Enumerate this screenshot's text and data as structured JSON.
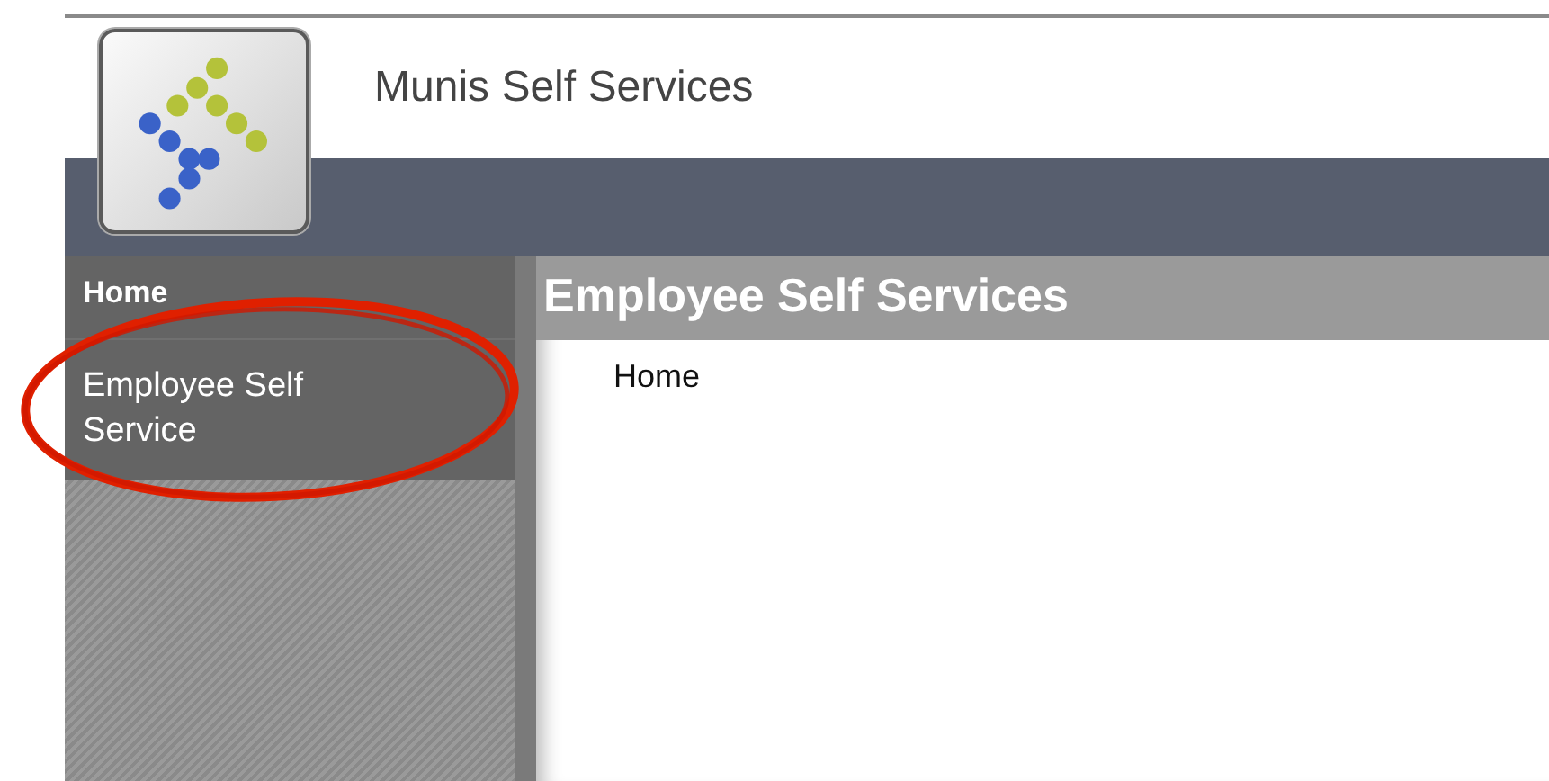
{
  "header": {
    "title": "Munis Self Services"
  },
  "sidebar": {
    "items": [
      {
        "label": "Home",
        "kind": "heading"
      },
      {
        "label": "Employee Self Service",
        "kind": "link"
      }
    ]
  },
  "content": {
    "title": "Employee Self Services",
    "breadcrumb": "Home"
  }
}
